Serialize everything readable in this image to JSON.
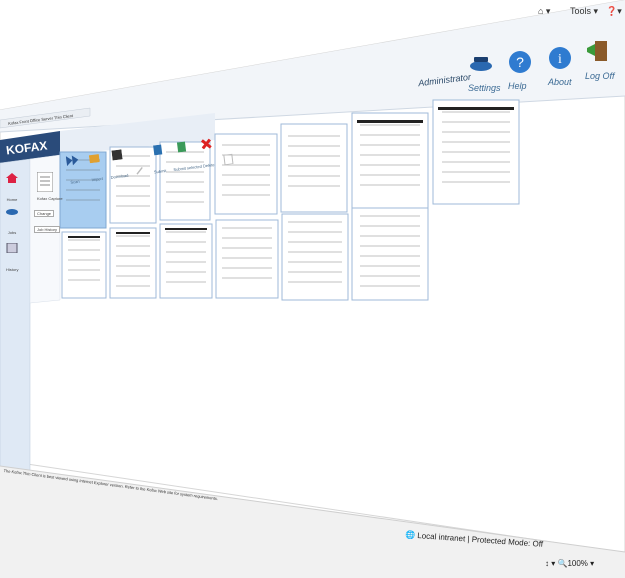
{
  "ie_toolbar": {
    "tools_label": "Tools ▾",
    "help_label": "❓▾",
    "home_label": "⌂ ▾"
  },
  "header": {
    "role": "Administrator",
    "nav": [
      {
        "label": "Settings"
      },
      {
        "label": "Help"
      },
      {
        "label": "About"
      },
      {
        "label": "Log Off"
      }
    ]
  },
  "window": {
    "title": "Kofax Front Office Server Thin Client"
  },
  "logo": "KOFAX",
  "toolbar": {
    "items": [
      "Scan",
      "Import",
      "Download",
      "",
      "Submit",
      "Submit selected",
      "Delete",
      ""
    ]
  },
  "sidebar": {
    "items": [
      "Home",
      "Jobs",
      "History"
    ]
  },
  "panel": {
    "shortcut_label": "Kofax Capture",
    "change_label": "Change",
    "job_label": "Job History"
  },
  "status_notice": "The Kofax Thin Client is best viewed using Internet Explorer version. Refer to the Kofax Web site for system requirements.",
  "ie_status": {
    "zone": "Local intranet | Protected Mode: Off",
    "zoom": "100%"
  },
  "colors": {
    "accent": "#1a5a8f",
    "selected": "#a8cdf0",
    "page_border": "#9fbad8"
  }
}
